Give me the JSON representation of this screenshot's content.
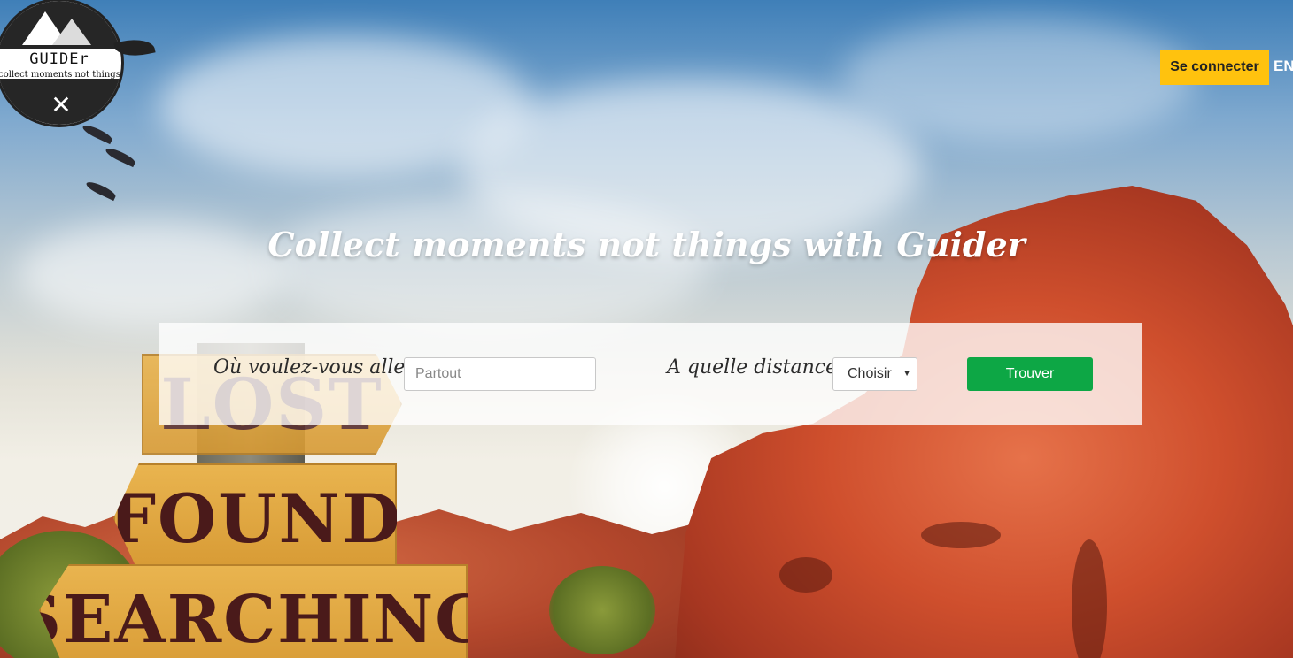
{
  "logo": {
    "name": "GUIDEr",
    "tagline": "collect moments not things"
  },
  "header": {
    "login_label": "Se connecter",
    "language_label": "EN"
  },
  "hero": {
    "headline": "Collect moments not things with Guider",
    "signs": [
      "LOST",
      "FOUND",
      "SEARCHING"
    ]
  },
  "search": {
    "where_label": "Où voulez-vous aller ?",
    "where_placeholder": "Partout",
    "distance_label": "A quelle distance ?",
    "distance_selected": "Choisir",
    "submit_label": "Trouver"
  },
  "colors": {
    "login_button": "#ffc20e",
    "submit_button": "#0da745"
  }
}
